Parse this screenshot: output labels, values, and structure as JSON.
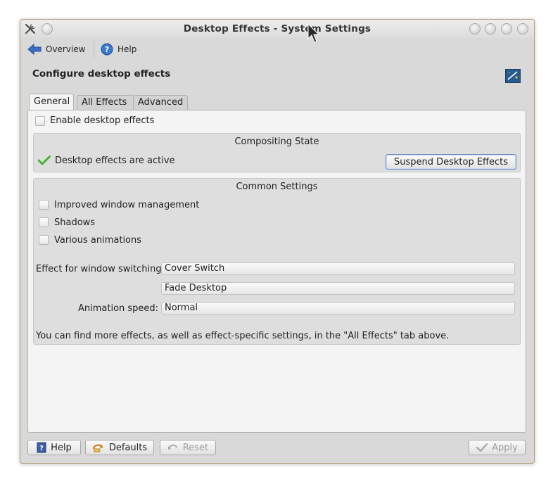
{
  "window": {
    "title": "Desktop Effects - System Settings"
  },
  "toolbar": {
    "overview_label": "Overview",
    "help_label": "Help"
  },
  "page": {
    "heading": "Configure desktop effects"
  },
  "tabs": [
    {
      "label": "General",
      "active": true
    },
    {
      "label": "All Effects",
      "active": false
    },
    {
      "label": "Advanced",
      "active": false
    }
  ],
  "general": {
    "enable_label": "Enable desktop effects",
    "enable_checked": false,
    "compositing": {
      "title": "Compositing State",
      "status_text": "Desktop effects are active",
      "suspend_label": "Suspend Desktop Effects"
    },
    "common": {
      "title": "Common Settings",
      "options": [
        {
          "label": "Improved window management",
          "checked": false
        },
        {
          "label": "Shadows",
          "checked": false
        },
        {
          "label": "Various animations",
          "checked": false
        }
      ],
      "window_switching_label": "Effect for window switching:",
      "window_switching_value": "Cover Switch",
      "desktop_switching_value": "Fade Desktop",
      "animation_speed_label": "Animation speed:",
      "animation_speed_value": "Normal",
      "info_text": "You can find more effects, as well as effect-specific settings, in the \"All Effects\" tab above."
    }
  },
  "footer": {
    "help_label": "Help",
    "defaults_label": "Defaults",
    "reset_label": "Reset",
    "apply_label": "Apply"
  },
  "colors": {
    "accent": "#6c8ec6",
    "check_green": "#4caf3a"
  }
}
